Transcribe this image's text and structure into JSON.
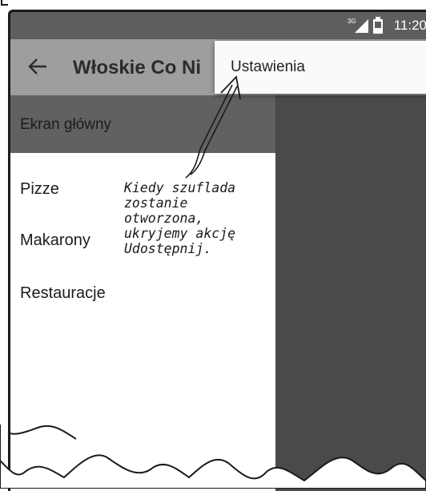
{
  "status_bar": {
    "network_badge": "3G",
    "time": "11:20"
  },
  "app_bar": {
    "title": "Włoskie Co Ni",
    "back_icon": "arrow-back-icon"
  },
  "overflow_menu": {
    "items": [
      {
        "label": "Ustawienia"
      }
    ]
  },
  "drawer": {
    "header_label": "Ekran główny",
    "items": [
      {
        "label": "Pizze"
      },
      {
        "label": "Makarony"
      },
      {
        "label": "Restauracje"
      }
    ]
  },
  "annotation": {
    "lines": [
      "Kiedy szuflada",
      "zostanie",
      "otworzona,",
      "ukryjemy akcję",
      "Udostępnij."
    ]
  },
  "colors": {
    "status_bar": "#5e5e5e",
    "app_bar": "#9e9e9e",
    "drawer_header": "#616161",
    "scrim": "#4a4a4a",
    "menu": "#fafafa"
  }
}
